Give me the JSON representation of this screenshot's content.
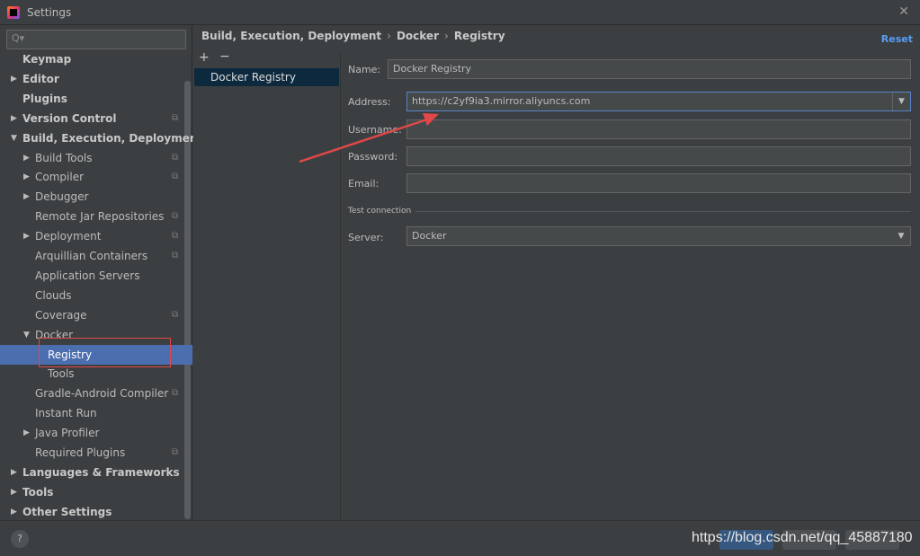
{
  "window": {
    "title": "Settings"
  },
  "search": {
    "placeholder": ""
  },
  "tree": [
    {
      "label": "Keymap",
      "level": 0,
      "bold": true,
      "arrow": "",
      "proj": false,
      "selected": false
    },
    {
      "label": "Editor",
      "level": 0,
      "bold": true,
      "arrow": "▶",
      "proj": false,
      "selected": false
    },
    {
      "label": "Plugins",
      "level": 0,
      "bold": true,
      "arrow": "",
      "proj": false,
      "selected": false
    },
    {
      "label": "Version Control",
      "level": 0,
      "bold": true,
      "arrow": "▶",
      "proj": true,
      "selected": false
    },
    {
      "label": "Build, Execution, Deployment",
      "level": 0,
      "bold": true,
      "arrow": "▼",
      "proj": false,
      "selected": false
    },
    {
      "label": "Build Tools",
      "level": 1,
      "bold": false,
      "arrow": "▶",
      "proj": true,
      "selected": false
    },
    {
      "label": "Compiler",
      "level": 1,
      "bold": false,
      "arrow": "▶",
      "proj": true,
      "selected": false
    },
    {
      "label": "Debugger",
      "level": 1,
      "bold": false,
      "arrow": "▶",
      "proj": false,
      "selected": false
    },
    {
      "label": "Remote Jar Repositories",
      "level": 1,
      "bold": false,
      "arrow": "",
      "proj": true,
      "selected": false
    },
    {
      "label": "Deployment",
      "level": 1,
      "bold": false,
      "arrow": "▶",
      "proj": true,
      "selected": false
    },
    {
      "label": "Arquillian Containers",
      "level": 1,
      "bold": false,
      "arrow": "",
      "proj": true,
      "selected": false
    },
    {
      "label": "Application Servers",
      "level": 1,
      "bold": false,
      "arrow": "",
      "proj": false,
      "selected": false
    },
    {
      "label": "Clouds",
      "level": 1,
      "bold": false,
      "arrow": "",
      "proj": false,
      "selected": false
    },
    {
      "label": "Coverage",
      "level": 1,
      "bold": false,
      "arrow": "",
      "proj": true,
      "selected": false
    },
    {
      "label": "Docker",
      "level": 1,
      "bold": false,
      "arrow": "▼",
      "proj": false,
      "selected": false
    },
    {
      "label": "Registry",
      "level": 2,
      "bold": false,
      "arrow": "",
      "proj": false,
      "selected": true
    },
    {
      "label": "Tools",
      "level": 2,
      "bold": false,
      "arrow": "",
      "proj": false,
      "selected": false
    },
    {
      "label": "Gradle-Android Compiler",
      "level": 1,
      "bold": false,
      "arrow": "",
      "proj": true,
      "selected": false
    },
    {
      "label": "Instant Run",
      "level": 1,
      "bold": false,
      "arrow": "",
      "proj": false,
      "selected": false
    },
    {
      "label": "Java Profiler",
      "level": 1,
      "bold": false,
      "arrow": "▶",
      "proj": false,
      "selected": false
    },
    {
      "label": "Required Plugins",
      "level": 1,
      "bold": false,
      "arrow": "",
      "proj": true,
      "selected": false
    },
    {
      "label": "Languages & Frameworks",
      "level": 0,
      "bold": true,
      "arrow": "▶",
      "proj": false,
      "selected": false
    },
    {
      "label": "Tools",
      "level": 0,
      "bold": true,
      "arrow": "▶",
      "proj": false,
      "selected": false
    },
    {
      "label": "Other Settings",
      "level": 0,
      "bold": true,
      "arrow": "▶",
      "proj": false,
      "selected": false
    }
  ],
  "breadcrumb": [
    "Build, Execution, Deployment",
    "Docker",
    "Registry"
  ],
  "breadcrumb_sep": "›",
  "reset_label": "Reset",
  "registry_list": {
    "add": "+",
    "remove": "−",
    "items": [
      "Docker Registry"
    ]
  },
  "form": {
    "name_label": "Name:",
    "name_value": "Docker Registry",
    "address_label": "Address:",
    "address_value": "https://c2yf9ia3.mirror.aliyuncs.com",
    "username_label": "Username:",
    "username_value": "",
    "password_label": "Password:",
    "password_value": "",
    "email_label": "Email:",
    "email_value": "",
    "section_label": "Test connection",
    "server_label": "Server:",
    "server_value": "Docker"
  },
  "help_label": "?",
  "watermark": "https://blog.csdn.net/qq_45887180",
  "colors": {
    "selection": "#4b6eaf",
    "annotation": "#e04848",
    "link": "#589df6"
  }
}
